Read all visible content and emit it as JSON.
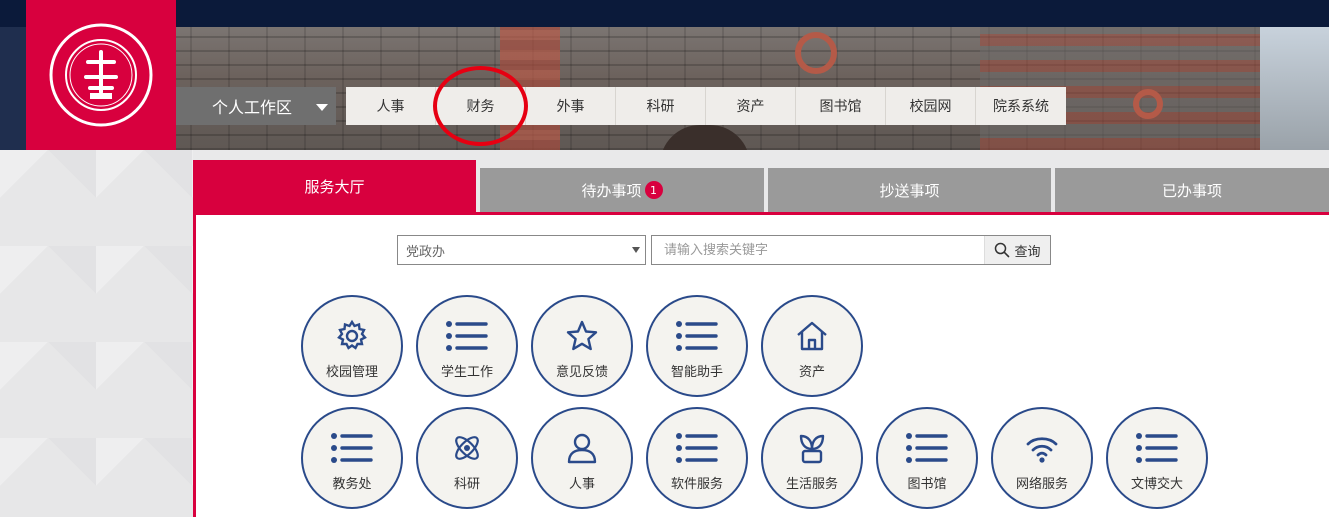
{
  "workspace": {
    "label": "个人工作区"
  },
  "top_nav": [
    "人事",
    "财务",
    "外事",
    "科研",
    "资产",
    "图书馆",
    "校园网",
    "院系系统"
  ],
  "tabs": [
    {
      "label": "服务大厅",
      "active": true
    },
    {
      "label": "待办事项",
      "badge": "1"
    },
    {
      "label": "抄送事项"
    },
    {
      "label": "已办事项"
    }
  ],
  "search": {
    "department": "党政办",
    "placeholder": "请输入搜索关键字",
    "button_label": "查询"
  },
  "services_row1": [
    {
      "label": "校园管理",
      "icon": "gear-icon"
    },
    {
      "label": "学生工作",
      "icon": "list-icon"
    },
    {
      "label": "意见反馈",
      "icon": "star-icon"
    },
    {
      "label": "智能助手",
      "icon": "list-icon"
    },
    {
      "label": "资产",
      "icon": "home-icon"
    }
  ],
  "services_row2": [
    {
      "label": "教务处",
      "icon": "list-icon"
    },
    {
      "label": "科研",
      "icon": "atom-icon"
    },
    {
      "label": "人事",
      "icon": "person-icon"
    },
    {
      "label": "软件服务",
      "icon": "list-icon"
    },
    {
      "label": "生活服务",
      "icon": "plant-icon"
    },
    {
      "label": "图书馆",
      "icon": "list-icon"
    },
    {
      "label": "网络服务",
      "icon": "wifi-icon"
    },
    {
      "label": "文博交大",
      "icon": "list-icon"
    }
  ],
  "colors": {
    "brand": "#d8003e",
    "icon": "#2a4a8a",
    "tab_inactive": "#9a9a9a"
  }
}
